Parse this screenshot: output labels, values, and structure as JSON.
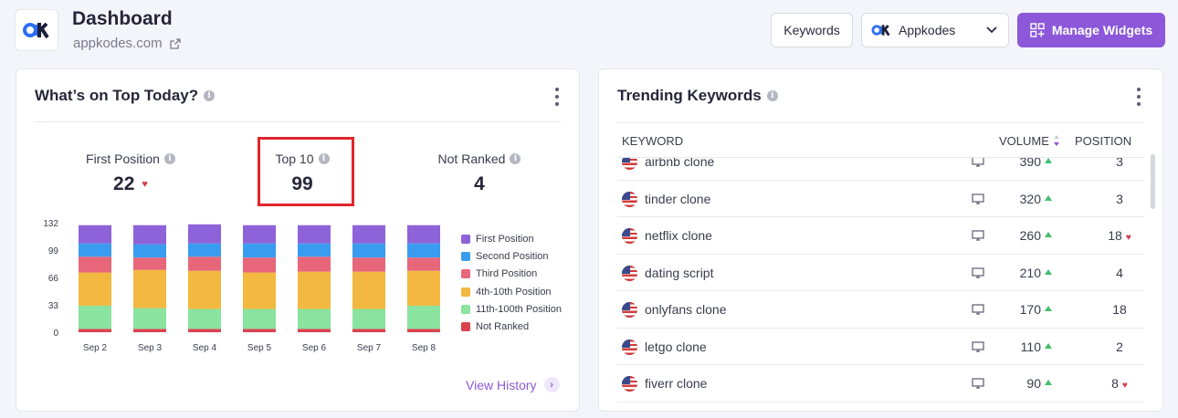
{
  "header": {
    "logo_text": "ak",
    "title": "Dashboard",
    "site": "appkodes.com",
    "keywords_button": "Keywords",
    "project_select": "Appkodes",
    "manage_widgets_button": "Manage Widgets"
  },
  "top_today": {
    "title": "What’s on Top Today?",
    "stats": [
      {
        "label": "First Position",
        "value": "22",
        "trend": "down"
      },
      {
        "label": "Top 10",
        "value": "99"
      },
      {
        "label": "Not Ranked",
        "value": "4"
      }
    ],
    "view_history": "View History",
    "chart_data": {
      "type": "bar",
      "stacked": true,
      "categories": [
        "Sep 2",
        "Sep 3",
        "Sep 4",
        "Sep 5",
        "Sep 6",
        "Sep 7",
        "Sep 8"
      ],
      "yticks": [
        "132",
        "99",
        "66",
        "33",
        "0"
      ],
      "ylim": [
        0,
        132
      ],
      "legend_position": "right",
      "series": [
        {
          "name": "Not Ranked",
          "color": "#d9434e",
          "values": [
            4,
            4,
            4,
            4,
            4,
            4,
            4
          ]
        },
        {
          "name": "11th-100th Position",
          "color": "#8ae39f",
          "values": [
            28,
            25,
            24,
            24,
            24,
            24,
            28
          ]
        },
        {
          "name": "4th-10th Position",
          "color": "#f2b83f",
          "values": [
            40,
            46,
            46,
            44,
            45,
            45,
            42
          ]
        },
        {
          "name": "Third Position",
          "color": "#e8667a",
          "values": [
            19,
            15,
            17,
            18,
            18,
            17,
            16
          ]
        },
        {
          "name": "Second Position",
          "color": "#3a9cf0",
          "values": [
            16,
            16,
            16,
            17,
            16,
            17,
            17
          ]
        },
        {
          "name": "First Position",
          "color": "#8e62d9",
          "values": [
            22,
            23,
            23,
            22,
            22,
            22,
            22
          ]
        }
      ]
    }
  },
  "trending": {
    "title": "Trending Keywords",
    "columns": {
      "keyword": "KEYWORD",
      "volume": "VOLUME",
      "position": "POSITION"
    },
    "rows": [
      {
        "keyword": "airbnb clone",
        "volume": "390",
        "position": "3",
        "down": false
      },
      {
        "keyword": "tinder clone",
        "volume": "320",
        "position": "3",
        "down": false
      },
      {
        "keyword": "netflix clone",
        "volume": "260",
        "position": "18",
        "down": true
      },
      {
        "keyword": "dating script",
        "volume": "210",
        "position": "4",
        "down": false
      },
      {
        "keyword": "onlyfans clone",
        "volume": "170",
        "position": "18",
        "down": false
      },
      {
        "keyword": "letgo clone",
        "volume": "110",
        "position": "2",
        "down": false
      },
      {
        "keyword": "fiverr clone",
        "volume": "90",
        "position": "8",
        "down": true
      }
    ]
  }
}
